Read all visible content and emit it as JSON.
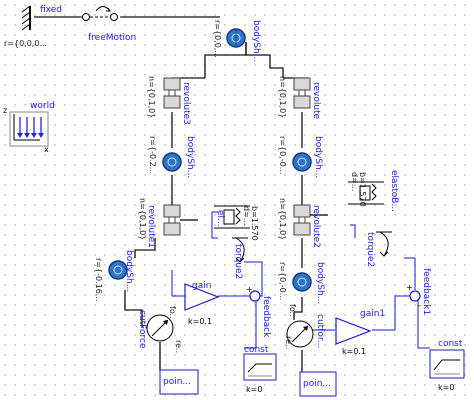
{
  "components": {
    "fixed": {
      "name": "fixed",
      "param": "r={0,0,0..."
    },
    "freeMotion": {
      "name": "freeMotion"
    },
    "world": {
      "name": "world",
      "axis_z": "z",
      "axis_x": "x"
    },
    "bodyShape_top": {
      "name": "bodySh...",
      "param": "r={0,0,..."
    },
    "revolute3": {
      "name": "revolute3",
      "param": "n={0,1,0}"
    },
    "revolute_right_top": {
      "name": "revolute",
      "param": "n={0,1,0}"
    },
    "bodyShape_left_mid": {
      "name": "bodySh...",
      "param": "r={-0.2..."
    },
    "bodyShape_right_mid": {
      "name": "bodySh...",
      "param": "r={0,-0..."
    },
    "revolute1": {
      "name": "revolute1",
      "param": "n={0,1,0}"
    },
    "revolute2": {
      "name": "revolute2",
      "param": "n={0,1,0}"
    },
    "elasto_left": {
      "name": "el...",
      "param_b": "b=1.570",
      "param_d": "d=..."
    },
    "elasto_right": {
      "name": "elastoB...",
      "param_b": "b=1.570",
      "param_d": "d=..."
    },
    "bodyShape_left_low": {
      "name": "bodySh...",
      "param": "r={-0.16..."
    },
    "bodyShape_right_low": {
      "name": "bodySh...",
      "param": "r={0,-0..."
    },
    "torque2_left": {
      "name": "torque2"
    },
    "torque2_right": {
      "name": "torque2"
    },
    "gain": {
      "name": "gain",
      "param": "k=0.1"
    },
    "gain1": {
      "name": "gain1",
      "param": "k=0.1"
    },
    "feedback": {
      "name": "feedback"
    },
    "feedback1": {
      "name": "feedback1"
    },
    "cutForce_left": {
      "name": "cutForce",
      "port1": "fo..",
      "port2": "re.."
    },
    "cutForce_right": {
      "name": "cutfor...",
      "port1": "fo..",
      "port2": "re.."
    },
    "const_left": {
      "name": "const",
      "param": "k=0"
    },
    "const_right": {
      "name": "const",
      "param": "k=0"
    },
    "point_left": {
      "name": "poin..."
    },
    "point_right": {
      "name": "poin..."
    },
    "feedback_signs": {
      "plus": "+",
      "minus": "-"
    }
  }
}
